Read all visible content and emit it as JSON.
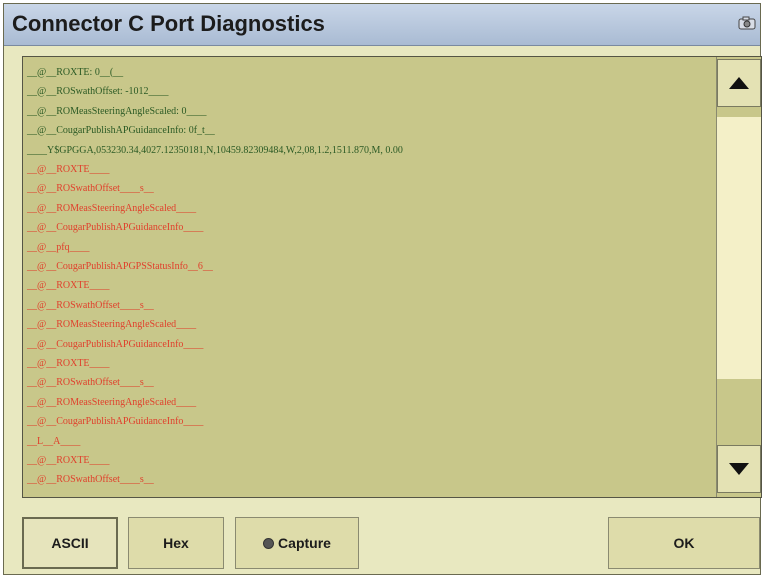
{
  "window": {
    "title": "Connector C Port Diagnostics",
    "title_icon": "camera-icon"
  },
  "log": {
    "lines": [
      {
        "text": "__@__ROXTE: 0__(__",
        "color": "green"
      },
      {
        "text": "__@__ROSwathOffset: -1012____",
        "color": "green"
      },
      {
        "text": "__@__ROMeasSteeringAngleScaled: 0____",
        "color": "green"
      },
      {
        "text": "__@__CougarPublishAPGuidanceInfo: 0f_t__",
        "color": "green"
      },
      {
        "text": "____Y$GPGGA,053230.34,4027.12350181,N,10459.82309484,W,2,08,1.2,1511.870,M, 0.00",
        "color": "green"
      },
      {
        "text": "__@__ROXTE____",
        "color": "red"
      },
      {
        "text": "__@__ROSwathOffset____s__",
        "color": "red"
      },
      {
        "text": "__@__ROMeasSteeringAngleScaled____",
        "color": "red"
      },
      {
        "text": "__@__CougarPublishAPGuidanceInfo____",
        "color": "red"
      },
      {
        "text": "__@__pfq____",
        "color": "red"
      },
      {
        "text": "__@__CougarPublishAPGPSStatusInfo__6__",
        "color": "red"
      },
      {
        "text": "__@__ROXTE____",
        "color": "red"
      },
      {
        "text": "__@__ROSwathOffset____s__",
        "color": "red"
      },
      {
        "text": "__@__ROMeasSteeringAngleScaled____",
        "color": "red"
      },
      {
        "text": "__@__CougarPublishAPGuidanceInfo____",
        "color": "red"
      },
      {
        "text": "__@__ROXTE____",
        "color": "red"
      },
      {
        "text": "__@__ROSwathOffset____s__",
        "color": "red"
      },
      {
        "text": "__@__ROMeasSteeringAngleScaled____",
        "color": "red"
      },
      {
        "text": "__@__CougarPublishAPGuidanceInfo____",
        "color": "red"
      },
      {
        "text": "__L__A____",
        "color": "red"
      },
      {
        "text": "__@__ROXTE____",
        "color": "red"
      },
      {
        "text": "__@__ROSwathOffset____s__",
        "color": "red"
      }
    ],
    "colors": {
      "green": "#2b5a24",
      "red": "#e0402c",
      "background": "#c8c78a"
    }
  },
  "scrollbar": {
    "up_icon": "triangle-up-icon",
    "down_icon": "triangle-down-icon"
  },
  "buttons": {
    "ascii": "ASCII",
    "hex": "Hex",
    "capture": "Capture",
    "capture_icon": "radio-indicator-icon",
    "ok": "OK",
    "selected": "ASCII"
  }
}
